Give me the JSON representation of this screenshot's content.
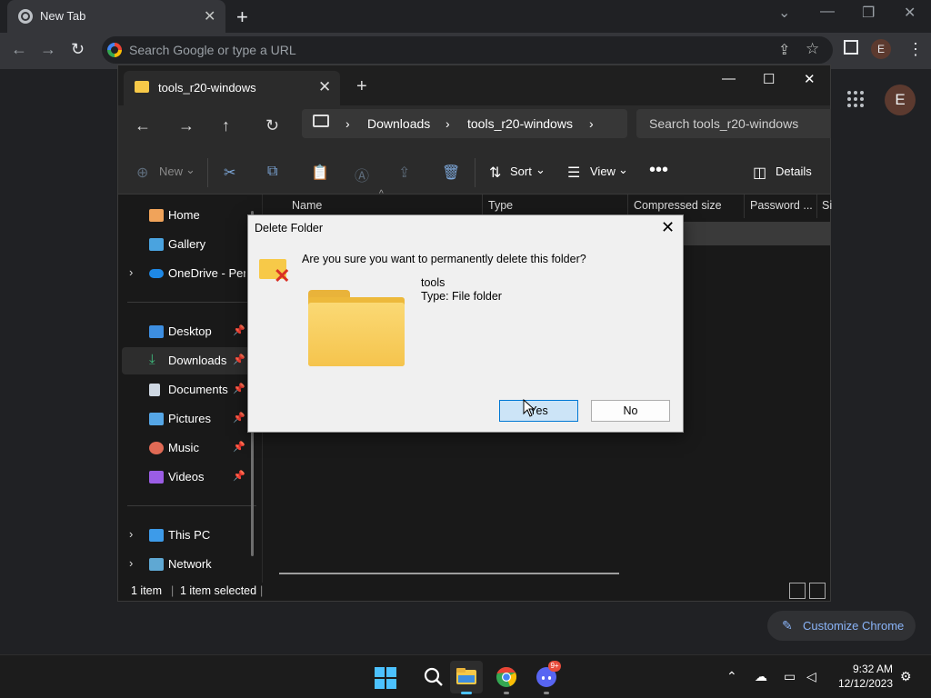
{
  "chrome": {
    "tab_title": "New Tab",
    "omnibox_placeholder": "Search Google or type a URL",
    "avatar_letter": "E",
    "customize_label": "Customize Chrome"
  },
  "explorer": {
    "tab_title": "tools_r20-windows",
    "breadcrumb": [
      "Downloads",
      "tools_r20-windows"
    ],
    "search_placeholder": "Search tools_r20-windows",
    "commands": {
      "new": "New",
      "sort": "Sort",
      "view": "View",
      "details": "Details"
    },
    "columns": [
      "Name",
      "Type",
      "Compressed size",
      "Password ...",
      "Si"
    ],
    "sidebar": [
      {
        "label": "Home",
        "icon": "home-icon"
      },
      {
        "label": "Gallery",
        "icon": "gallery-icon"
      },
      {
        "label": "OneDrive - Personal",
        "icon": "onedrive-icon"
      },
      {
        "label": "Desktop",
        "icon": "desktop-icon"
      },
      {
        "label": "Downloads",
        "icon": "download-icon"
      },
      {
        "label": "Documents",
        "icon": "documents-icon"
      },
      {
        "label": "Pictures",
        "icon": "pictures-icon"
      },
      {
        "label": "Music",
        "icon": "music-icon"
      },
      {
        "label": "Videos",
        "icon": "videos-icon"
      },
      {
        "label": "This PC",
        "icon": "pc-icon"
      },
      {
        "label": "Network",
        "icon": "network-icon"
      }
    ],
    "status": {
      "items": "1 item",
      "selected": "1 item selected"
    }
  },
  "dialog": {
    "title": "Delete Folder",
    "message": "Are you sure you want to permanently delete this folder?",
    "item_name": "tools",
    "item_type": "Type: File folder",
    "yes_label": "Yes",
    "no_label": "No"
  },
  "taskbar": {
    "time": "9:32 AM",
    "date": "12/12/2023",
    "discord_badge": "9+"
  },
  "colors": {
    "accent": "#0078d4",
    "chrome_bg": "#202124",
    "folder_yellow": "#f7c948"
  }
}
